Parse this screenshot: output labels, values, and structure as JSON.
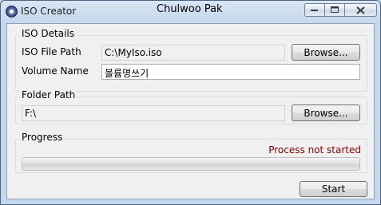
{
  "window": {
    "title": "ISO Creator",
    "center_title": "Chulwoo Pak",
    "controls": {
      "minimize_icon": "minimize-icon",
      "maximize_icon": "maximize-icon",
      "close_icon": "close-icon"
    }
  },
  "iso_details": {
    "group_label": "ISO Details",
    "iso_file_path_label": "ISO File Path",
    "iso_file_path_value": "C:\\MyIso.iso",
    "browse_label": "Browse...",
    "volume_name_label": "Volume Name",
    "volume_name_value": "볼륨명쓰기"
  },
  "folder_path": {
    "group_label": "Folder Path",
    "value": "F:\\",
    "browse_label": "Browse..."
  },
  "progress": {
    "group_label": "Progress",
    "status_text": "Process not started",
    "status_color": "#800000",
    "value_percent": 0
  },
  "actions": {
    "start_label": "Start"
  }
}
